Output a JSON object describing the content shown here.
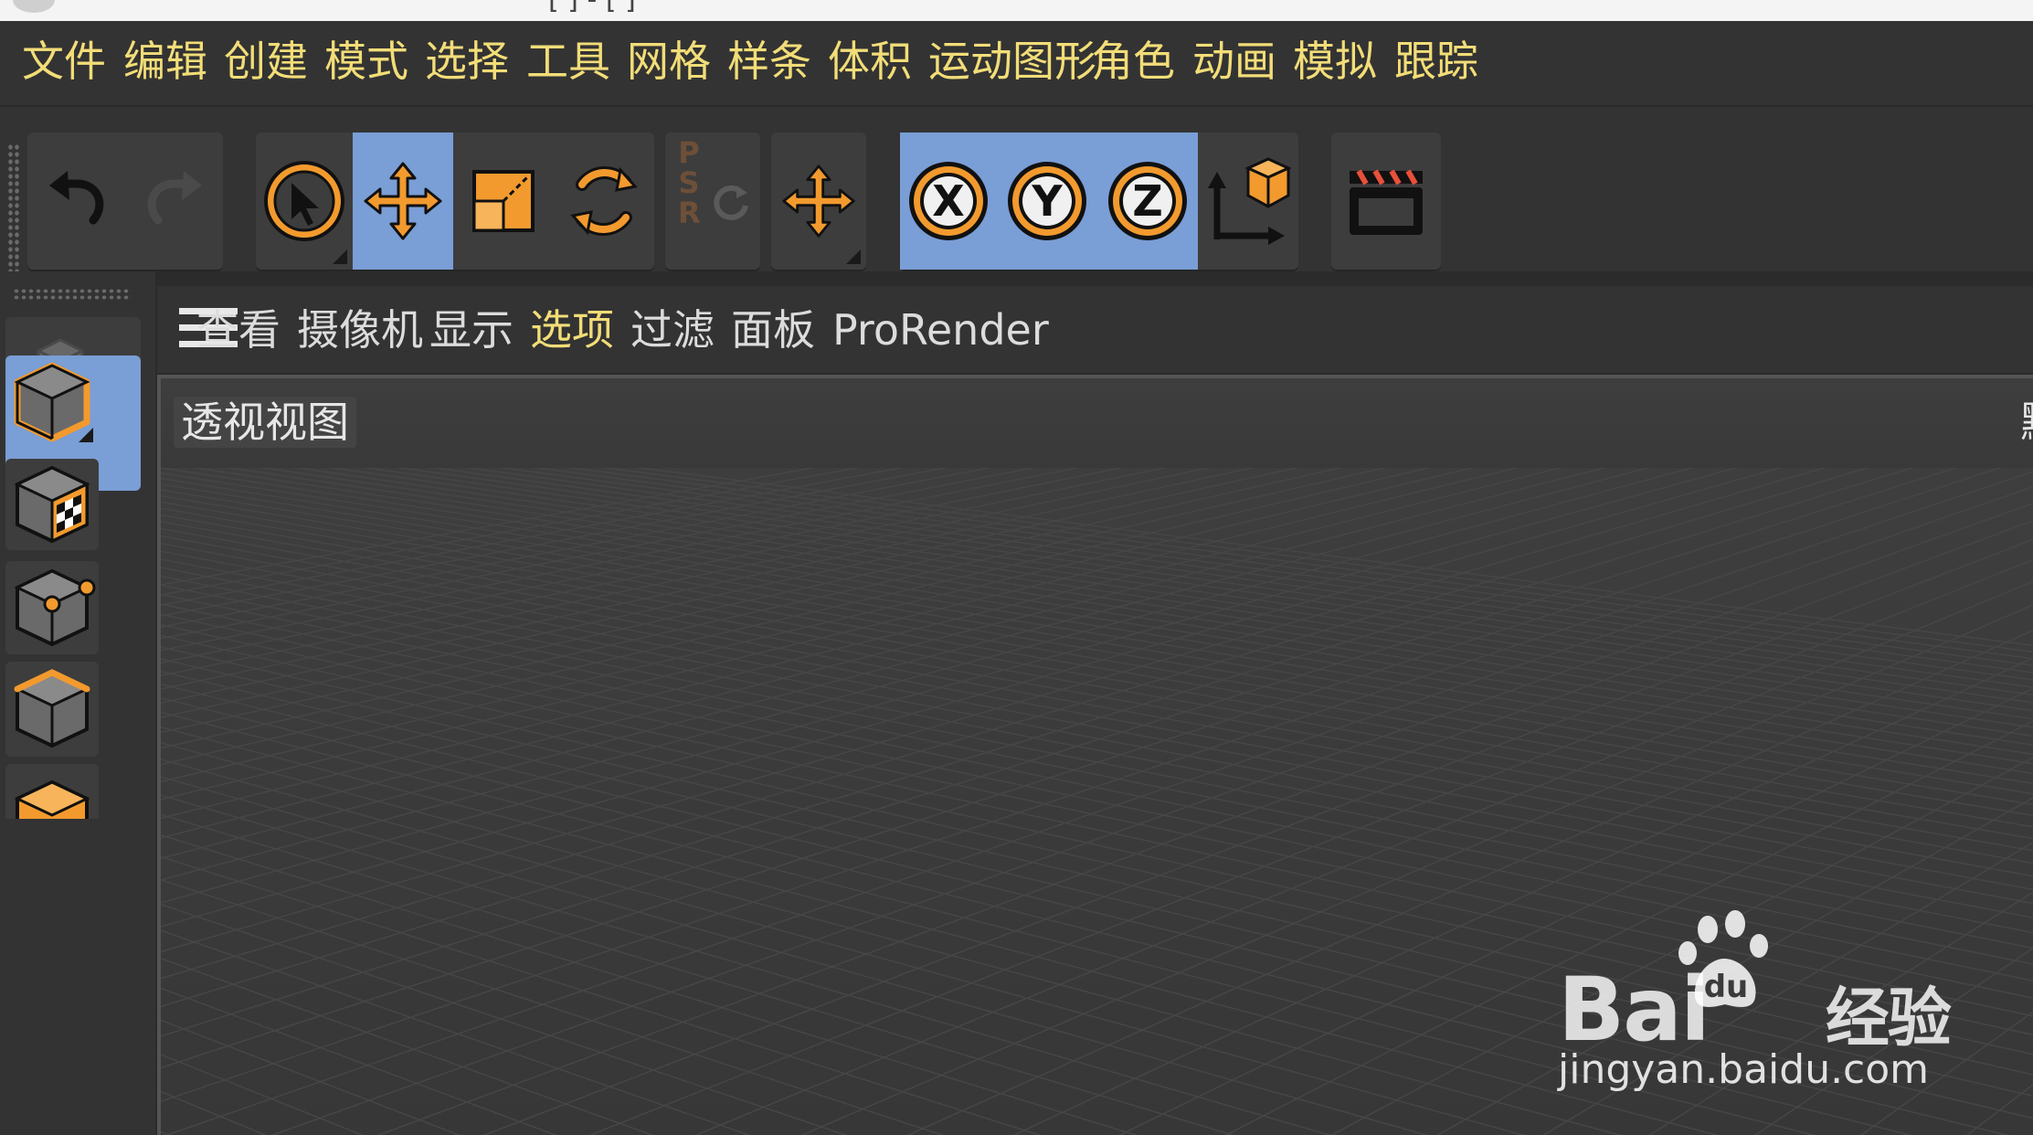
{
  "titlebar": {
    "title_fragment": "[  ] - [  ]"
  },
  "menubar": {
    "items": [
      "文件",
      "编辑",
      "创建",
      "模式",
      "选择",
      "工具",
      "网格",
      "样条",
      "体积",
      "运动图形",
      "角色",
      "动画",
      "模拟",
      "跟踪"
    ]
  },
  "toolbar": {
    "history": [
      {
        "icon": "undo-icon",
        "enabled": true
      },
      {
        "icon": "redo-icon",
        "enabled": false
      }
    ],
    "transform_tools": [
      {
        "icon": "live-select-icon",
        "active": false
      },
      {
        "icon": "move-icon",
        "active": true
      },
      {
        "icon": "scale-icon",
        "active": false
      },
      {
        "icon": "rotate-icon",
        "active": false
      }
    ],
    "psr": {
      "letters": [
        "P",
        "S",
        "R"
      ],
      "enabled": false
    },
    "axis_locks": [
      {
        "icon": "x-axis-icon",
        "label": "X",
        "active": true
      },
      {
        "icon": "y-axis-icon",
        "label": "Y",
        "active": true
      },
      {
        "icon": "z-axis-icon",
        "label": "Z",
        "active": true
      }
    ],
    "coordinate_system_icon": "world-coordinate-icon",
    "render_icon": "clapperboard-icon"
  },
  "left_palette": {
    "items": [
      {
        "icon": "make-editable-icon",
        "active": false
      },
      {
        "icon": "model-mode-icon",
        "active": true
      },
      {
        "icon": "texture-mode-icon",
        "active": false
      },
      {
        "icon": "point-mode-icon",
        "active": false
      },
      {
        "icon": "edge-mode-icon",
        "active": false
      },
      {
        "icon": "polygon-mode-icon",
        "active": false
      }
    ]
  },
  "viewport_menu": {
    "items": [
      "查看",
      "摄像机",
      "显示",
      "选项",
      "过滤",
      "面板",
      "ProRender"
    ],
    "highlighted": "选项"
  },
  "viewport": {
    "label": "透视视图",
    "right_label_fragment": "默"
  },
  "watermark": {
    "brand": "Bai",
    "brand_suffix": "经验",
    "url": "jingyan.baidu.com"
  },
  "colors": {
    "accent_orange": "#f29a2e",
    "active_blue": "#7a9ed6",
    "menu_yellow": "#f2dd78",
    "background": "#333333"
  }
}
